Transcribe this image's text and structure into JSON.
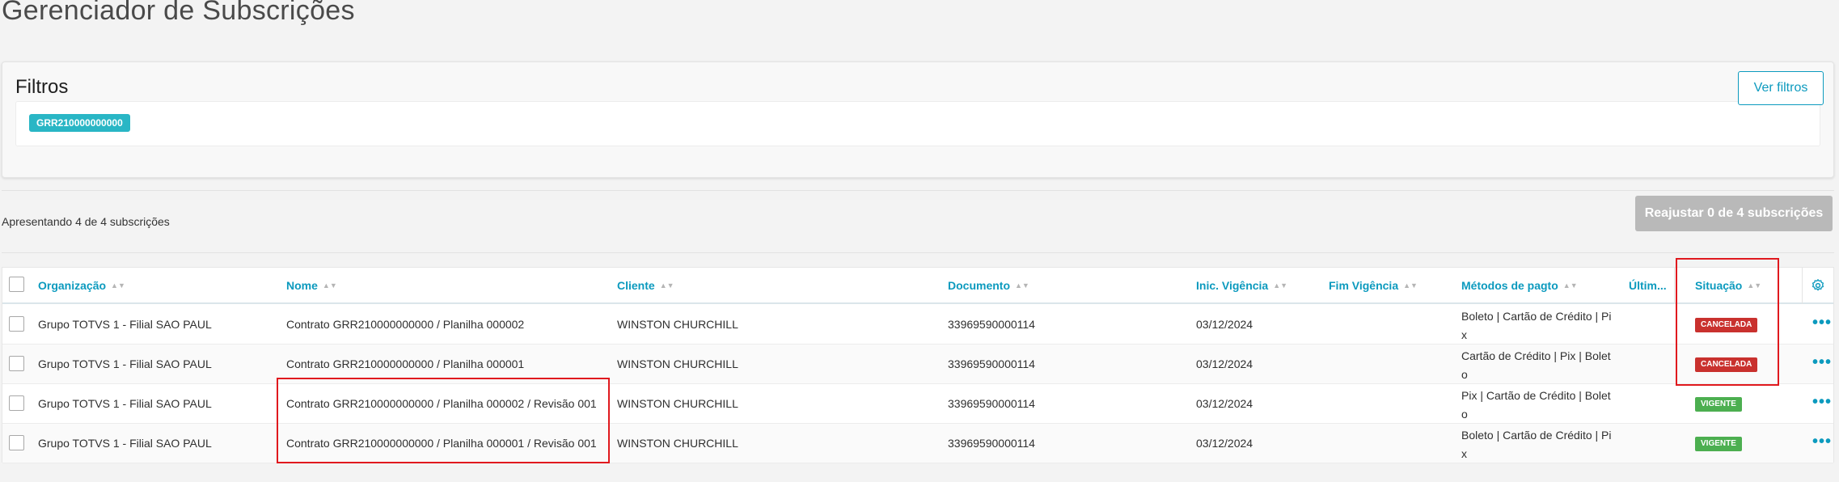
{
  "page": {
    "title": "Gerenciador de Subscrições"
  },
  "filters": {
    "title": "Filtros",
    "chip": "GRR210000000000",
    "ver_filtros": "Ver filtros"
  },
  "summary": {
    "text": "Apresentando 4 de 4 subscrições",
    "reajustar": "Reajustar 0 de 4 subscrições"
  },
  "table": {
    "columns": {
      "organizacao": "Organização",
      "nome": "Nome",
      "cliente": "Cliente",
      "documento": "Documento",
      "inicio": "Inic. Vigência",
      "fim": "Fim Vigência",
      "metodos": "Métodos de pagto",
      "ultimo": "Últim...",
      "situacao": "Situação"
    },
    "rows": [
      {
        "organizacao": "Grupo TOTVS 1 - Filial SAO PAUL",
        "nome": "Contrato GRR210000000000 / Planilha 000002",
        "cliente": "WINSTON CHURCHILL",
        "documento": "33969590000114",
        "inicio": "03/12/2024",
        "fim": "",
        "metodos": "Boleto | Cartão de Crédito | Pix",
        "situacao": "CANCELADA"
      },
      {
        "organizacao": "Grupo TOTVS 1 - Filial SAO PAUL",
        "nome": "Contrato GRR210000000000 / Planilha 000001",
        "cliente": "WINSTON CHURCHILL",
        "documento": "33969590000114",
        "inicio": "03/12/2024",
        "fim": "",
        "metodos": "Cartão de Crédito | Pix | Boleto",
        "situacao": "CANCELADA"
      },
      {
        "organizacao": "Grupo TOTVS 1 - Filial SAO PAUL",
        "nome": "Contrato GRR210000000000 / Planilha 000002 / Revisão 001",
        "cliente": "WINSTON CHURCHILL",
        "documento": "33969590000114",
        "inicio": "03/12/2024",
        "fim": "",
        "metodos": "Pix | Cartão de Crédito | Boleto",
        "situacao": "VIGENTE"
      },
      {
        "organizacao": "Grupo TOTVS 1 - Filial SAO PAUL",
        "nome": "Contrato GRR210000000000 / Planilha 000001 / Revisão 001",
        "cliente": "WINSTON CHURCHILL",
        "documento": "33969590000114",
        "inicio": "03/12/2024",
        "fim": "",
        "metodos": "Boleto | Cartão de Crédito | Pix",
        "situacao": "VIGENTE"
      }
    ]
  },
  "icons": {
    "sort": "sort-arrows-icon",
    "settings": "gear-icon",
    "actions": "more-dots-icon"
  },
  "colors": {
    "accent": "#0c9abe",
    "chip": "#29b6c5",
    "cancelada": "#c9312e",
    "vigente": "#4caf50",
    "highlight": "#e0191e"
  }
}
